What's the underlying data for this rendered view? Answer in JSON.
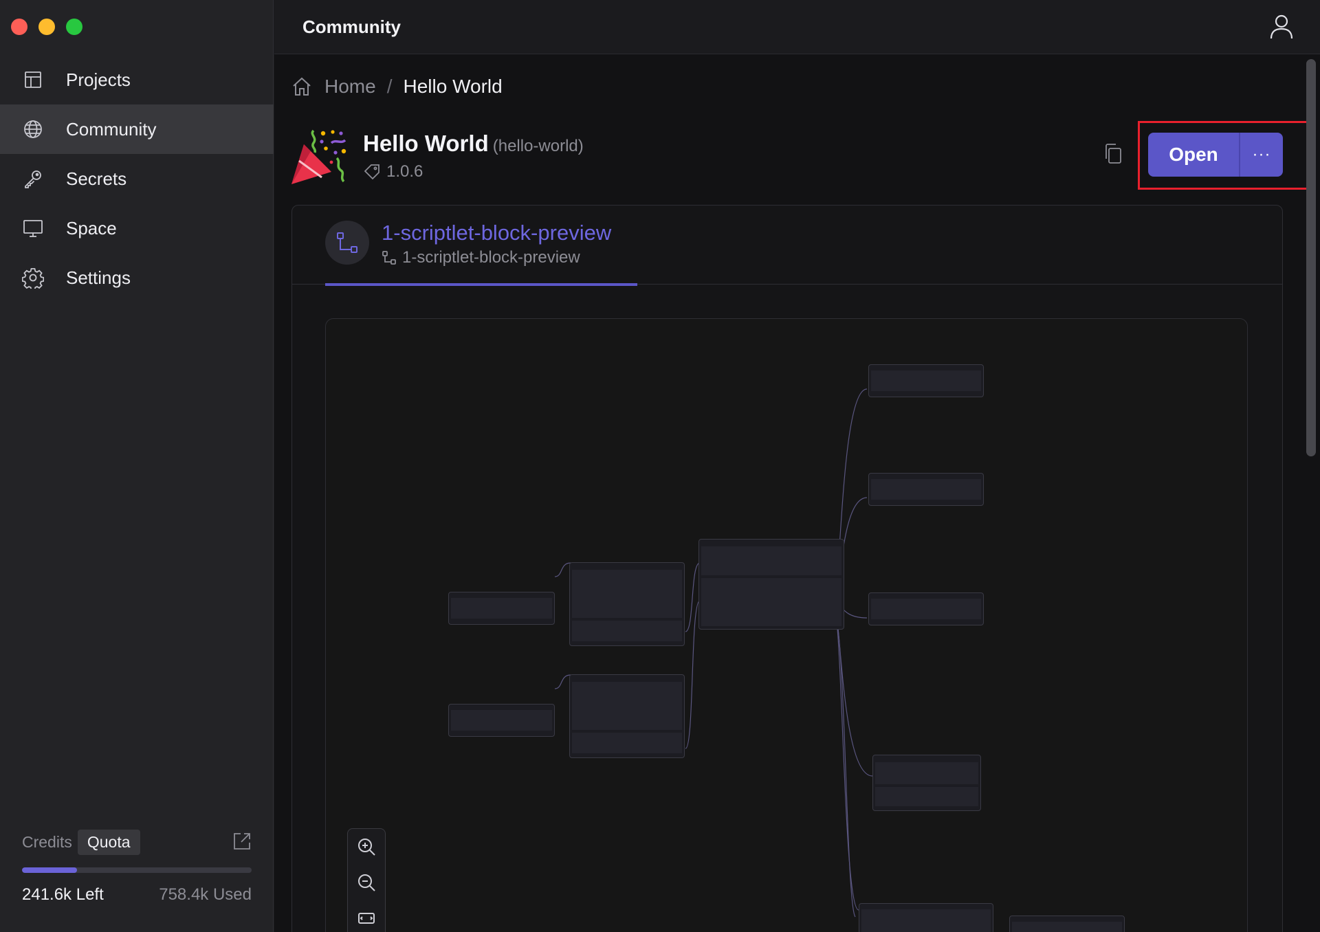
{
  "window": {
    "controls": [
      "close",
      "minimize",
      "maximize"
    ]
  },
  "sidebar": {
    "items": [
      {
        "label": "Projects",
        "icon": "table-icon"
      },
      {
        "label": "Community",
        "icon": "globe-icon",
        "active": true
      },
      {
        "label": "Secrets",
        "icon": "key-icon"
      },
      {
        "label": "Space",
        "icon": "monitor-icon"
      },
      {
        "label": "Settings",
        "icon": "gear-icon"
      }
    ],
    "credits": {
      "tab_credits": "Credits",
      "tab_quota": "Quota",
      "selected_tab": "Quota",
      "left": "241.6k Left",
      "used": "758.4k Used",
      "progress_fraction": 0.24
    }
  },
  "topbar": {
    "title": "Community",
    "user_icon": "user-icon"
  },
  "breadcrumb": {
    "home": "Home",
    "separator": "/",
    "current": "Hello World"
  },
  "package": {
    "name": "Hello World",
    "slug": "(hello-world)",
    "version": "1.0.6",
    "icon": "party-popper-icon"
  },
  "actions": {
    "open_label": "Open",
    "more_label": "···"
  },
  "scriptlet_tab": {
    "title": "1-scriptlet-block-preview",
    "subtitle": "1-scriptlet-block-preview"
  },
  "colors": {
    "accent": "#5b56c8",
    "highlight": "#e8202d",
    "link": "#6e67e0"
  }
}
